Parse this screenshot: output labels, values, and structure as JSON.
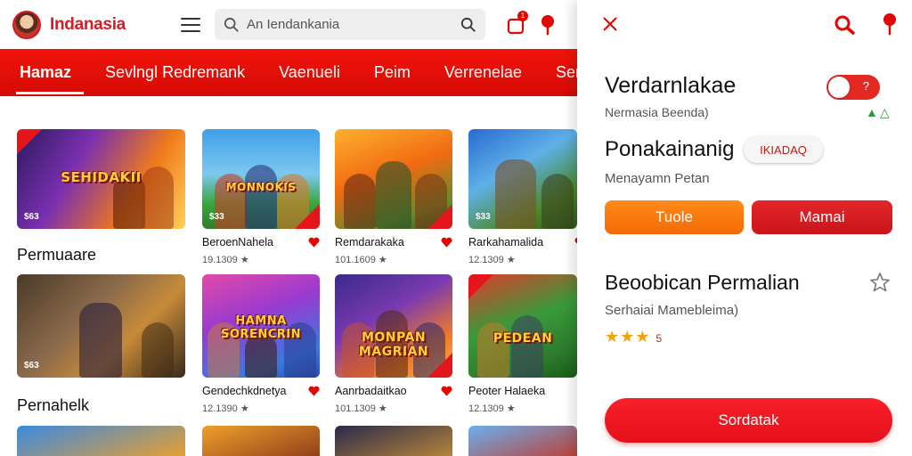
{
  "app": {
    "brand": "Indanasia",
    "search_placeholder": "An Iendankania",
    "notification_count": "1",
    "colors": {
      "accent": "#e10600",
      "tabbar": "#e5100a",
      "orange": "#f47b0f"
    }
  },
  "tabs": [
    {
      "label": "Hamaz",
      "active": true
    },
    {
      "label": "Sevlngl Redremank",
      "active": false
    },
    {
      "label": "Vaenueli",
      "active": false
    },
    {
      "label": "Peim",
      "active": false
    },
    {
      "label": "Verrenelae",
      "active": false
    },
    {
      "label": "Serdan",
      "active": false
    }
  ],
  "sections": [
    {
      "title": "Permuaare"
    },
    {
      "title": "Pernahelk"
    }
  ],
  "cards": [
    {
      "thumb_title": "SEHIDAKII",
      "count": "$63",
      "name": "",
      "meta": ""
    },
    {
      "thumb_title": "MONNOKIS",
      "count": "$33",
      "name": "BeroenNahela",
      "meta": "19.1309 ★"
    },
    {
      "thumb_title": "",
      "count": "",
      "name": "Remdarakaka",
      "meta": "101.1609 ★"
    },
    {
      "thumb_title": "",
      "count": "$33",
      "name": "Rarkahamalida",
      "meta": "12.1309 ★"
    },
    {
      "thumb_title": "",
      "count": "$63",
      "name": "",
      "meta": ""
    },
    {
      "thumb_title": "HAMNA SORENCRIN",
      "count": "",
      "name": "Gendechkdnetya",
      "meta": "12.1390 ★"
    },
    {
      "thumb_title": "MONPAN MAGRIAN",
      "count": "",
      "name": "Aanrbadaitkao",
      "meta": "101.1309 ★"
    },
    {
      "thumb_title": "PEDEAN",
      "count": "",
      "name": "Peoter Halaeka",
      "meta": "12.1309 ★"
    }
  ],
  "panel": {
    "heading1": "Verdarnlakae",
    "sub1": "Nermasia Beenda)",
    "toggle_glyph": "?",
    "tri_icons": "▲△",
    "heading2": "Ponakainanig",
    "chip_label": "IKIADAQ",
    "sub2": "Menayamn Petan",
    "btn_orange": "Tuole",
    "btn_red": "Mamai",
    "heading3": "Beoobican Permalian",
    "sub3": "Serhaiai Mamebleima)",
    "rating_stars": "★★★",
    "rating_value": "5",
    "main_button": "Sordatak"
  }
}
